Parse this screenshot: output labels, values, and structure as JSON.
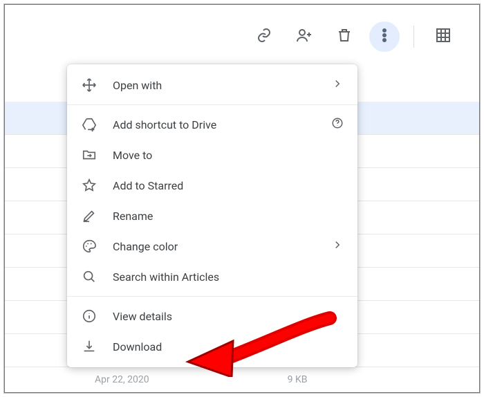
{
  "toolbar": {
    "link": "Get link",
    "share": "Share",
    "trash": "Remove",
    "more": "More actions",
    "grid": "Grid view"
  },
  "menu": {
    "open_with": "Open with",
    "add_shortcut": "Add shortcut to Drive",
    "move_to": "Move to",
    "add_starred": "Add to Starred",
    "rename": "Rename",
    "change_color": "Change color",
    "search_within": "Search within Articles",
    "view_details": "View details",
    "download": "Download"
  },
  "footer": {
    "date": "Apr 22, 2020",
    "size": "9 KB"
  }
}
